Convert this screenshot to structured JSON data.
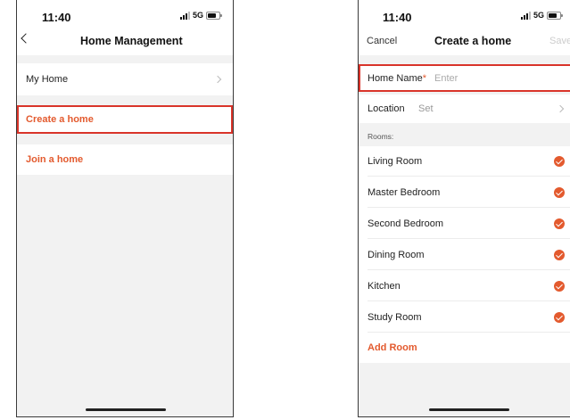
{
  "left_screen": {
    "status": {
      "time": "11:40",
      "network": "5G"
    },
    "nav": {
      "title": "Home Management"
    },
    "items": {
      "my_home": "My Home",
      "create_home": "Create a home",
      "join_home": "Join a home"
    }
  },
  "right_screen": {
    "status": {
      "time": "11:40",
      "network": "5G"
    },
    "nav": {
      "cancel": "Cancel",
      "title": "Create a home",
      "save": "Save"
    },
    "home_name": {
      "label": "Home Name",
      "required_mark": "*",
      "placeholder": "Enter"
    },
    "location": {
      "label": "Location",
      "value": "Set"
    },
    "rooms_header": "Rooms:",
    "rooms": [
      "Living Room",
      "Master Bedroom",
      "Second Bedroom",
      "Dining Room",
      "Kitchen",
      "Study Room"
    ],
    "add_room": "Add Room"
  },
  "colors": {
    "accent": "#e35a2e",
    "highlight": "#d9342a",
    "background": "#f2f2f2"
  }
}
